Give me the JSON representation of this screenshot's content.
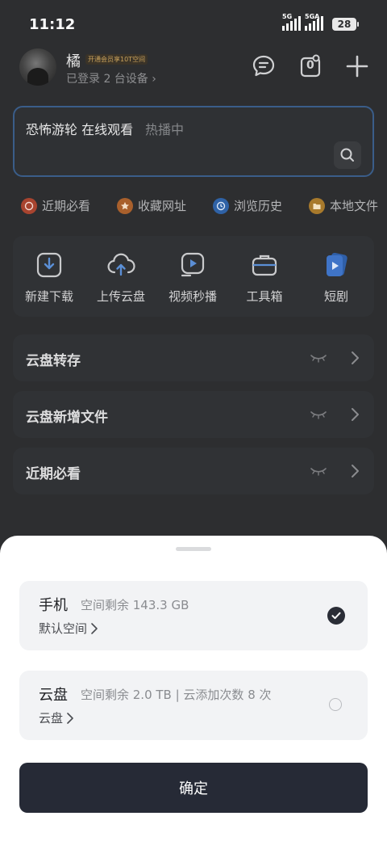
{
  "status_bar": {
    "time": "11:12",
    "network1": "5G",
    "network2": "5GA",
    "battery": "28"
  },
  "header": {
    "user_name": "橘",
    "vip_badge": "开通会员享10T空间",
    "device_line": "已登录 2 台设备 ›",
    "icons": [
      "chat-bubble-icon",
      "task-count-icon",
      "plus-icon"
    ],
    "task_count": "0"
  },
  "search": {
    "query": "恐怖游轮 在线观看",
    "hot_label": "热播中"
  },
  "quick_links": [
    {
      "label": "近期必看",
      "color": "#e0543a"
    },
    {
      "label": "收藏网址",
      "color": "#e07a30"
    },
    {
      "label": "浏览历史",
      "color": "#3b7fd9"
    },
    {
      "label": "本地文件",
      "color": "#e89a2c"
    }
  ],
  "tools": [
    {
      "label": "新建下载",
      "icon": "download-icon"
    },
    {
      "label": "上传云盘",
      "icon": "cloud-upload-icon"
    },
    {
      "label": "视频秒播",
      "icon": "video-play-icon"
    },
    {
      "label": "工具箱",
      "icon": "toolbox-icon"
    },
    {
      "label": "短剧",
      "icon": "short-drama-icon"
    }
  ],
  "sections": [
    {
      "title": "云盘转存"
    },
    {
      "title": "云盘新增文件"
    },
    {
      "title": "近期必看"
    }
  ],
  "sheet": {
    "options": [
      {
        "title": "手机",
        "info": "空间剩余 143.3 GB",
        "sub": "默认空间",
        "selected": true
      },
      {
        "title": "云盘",
        "info": "空间剩余 2.0 TB | 云添加次数 8 次",
        "sub": "云盘",
        "selected": false
      }
    ],
    "confirm_label": "确定"
  },
  "colors": {
    "accent_dark": "#262a36",
    "search_border": "#3a5d89"
  }
}
